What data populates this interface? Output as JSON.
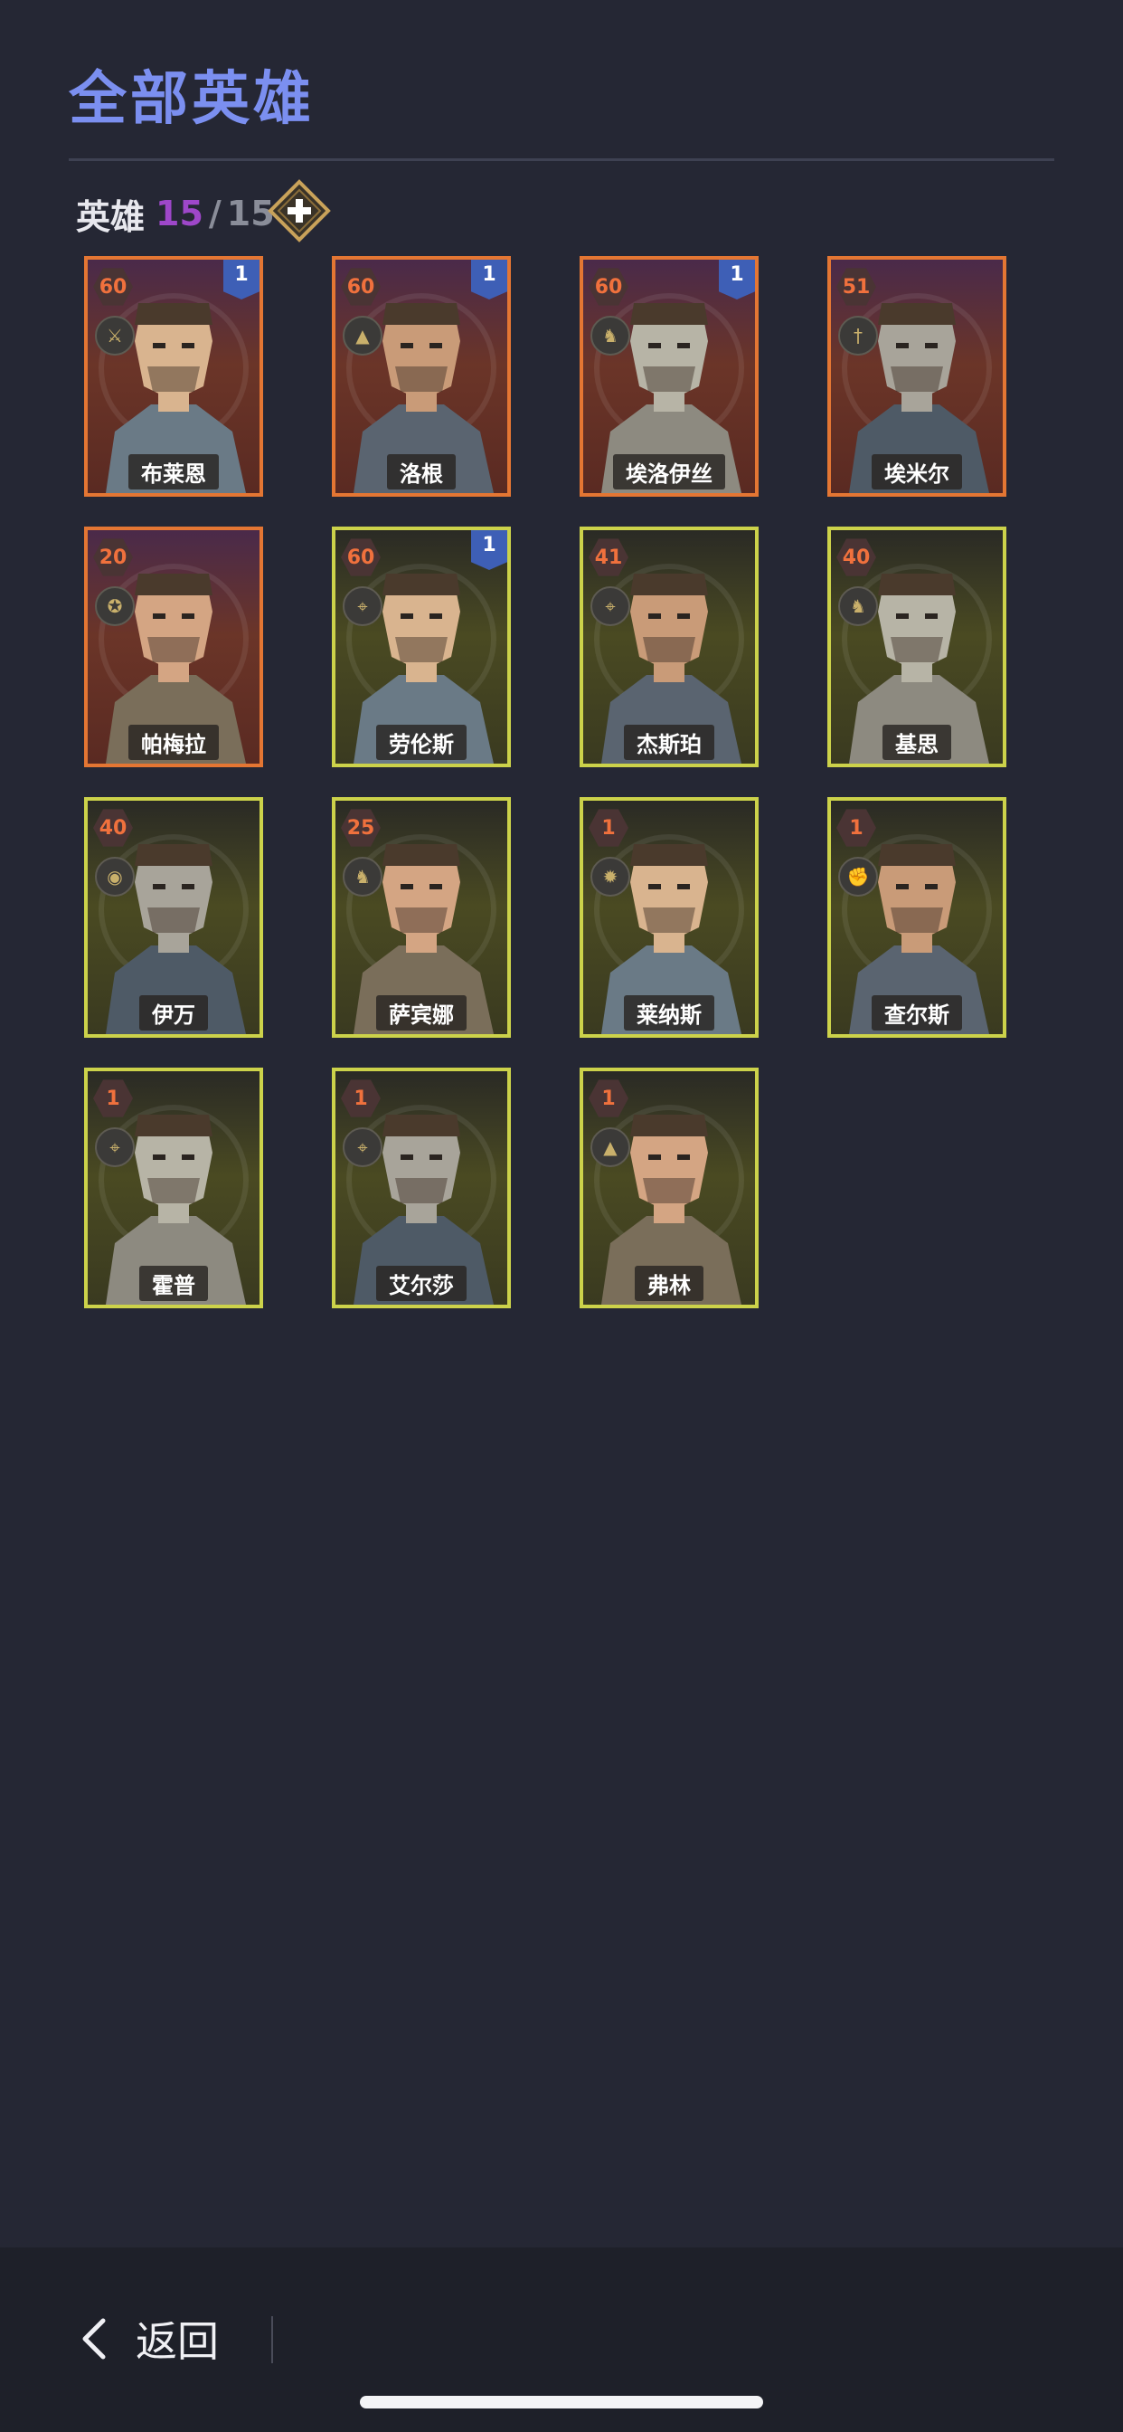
{
  "header": {
    "title": "全部英雄"
  },
  "roster": {
    "label": "英雄",
    "current": "15",
    "separator": "/",
    "max": "15",
    "add_icon": "plus-diamond-icon"
  },
  "colors": {
    "title": "#7b8ff0",
    "count_current": "#9e47c9",
    "rarity_orange": "#e47633",
    "rarity_yellow": "#ccd24a",
    "level_text": "#f0713d",
    "badge_blue": "#3e5fb6"
  },
  "heroes": [
    {
      "name": "布莱恩",
      "level": "60",
      "badge": "1",
      "rarity": "orange",
      "class_icon": "sword-icon"
    },
    {
      "name": "洛根",
      "level": "60",
      "badge": "1",
      "rarity": "orange",
      "class_icon": "hat-icon"
    },
    {
      "name": "埃洛伊丝",
      "level": "60",
      "badge": "1",
      "rarity": "orange",
      "class_icon": "horse-icon"
    },
    {
      "name": "埃米尔",
      "level": "51",
      "badge": "",
      "rarity": "orange",
      "class_icon": "dagger-icon"
    },
    {
      "name": "帕梅拉",
      "level": "20",
      "badge": "",
      "rarity": "orange",
      "class_icon": "pentagram-icon"
    },
    {
      "name": "劳伦斯",
      "level": "60",
      "badge": "1",
      "rarity": "yellow",
      "class_icon": "crosshair-icon"
    },
    {
      "name": "杰斯珀",
      "level": "41",
      "badge": "",
      "rarity": "yellow",
      "class_icon": "crosshair-icon"
    },
    {
      "name": "基思",
      "level": "40",
      "badge": "",
      "rarity": "yellow",
      "class_icon": "horse-icon"
    },
    {
      "name": "伊万",
      "level": "40",
      "badge": "",
      "rarity": "yellow",
      "class_icon": "eye-icon"
    },
    {
      "name": "萨宾娜",
      "level": "25",
      "badge": "",
      "rarity": "yellow",
      "class_icon": "horse-icon"
    },
    {
      "name": "莱纳斯",
      "level": "1",
      "badge": "",
      "rarity": "yellow",
      "class_icon": "gear-icon"
    },
    {
      "name": "查尔斯",
      "level": "1",
      "badge": "",
      "rarity": "yellow",
      "class_icon": "fist-icon"
    },
    {
      "name": "霍普",
      "level": "1",
      "badge": "",
      "rarity": "yellow",
      "class_icon": "crosshair-icon"
    },
    {
      "name": "艾尔莎",
      "level": "1",
      "badge": "",
      "rarity": "yellow",
      "class_icon": "crosshair-icon"
    },
    {
      "name": "弗林",
      "level": "1",
      "badge": "",
      "rarity": "yellow",
      "class_icon": "hat-icon"
    }
  ],
  "footer": {
    "back_label": "返回",
    "back_icon": "chevron-left-icon"
  }
}
